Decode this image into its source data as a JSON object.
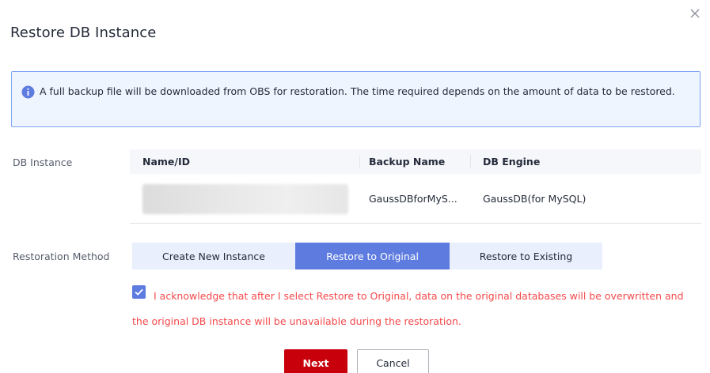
{
  "dialog": {
    "title": "Restore DB Instance",
    "close_icon": "close-icon"
  },
  "notice": {
    "icon": "info-icon",
    "text": "A full backup file will be downloaded from OBS for restoration. The time required depends on the amount of data to be restored."
  },
  "db_instance": {
    "label": "DB Instance",
    "columns": [
      "Name/ID",
      "Backup Name",
      "DB Engine"
    ],
    "rows": [
      {
        "name_id": "",
        "backup_name": "GaussDBforMyS...",
        "db_engine": "GaussDB(for MySQL)"
      }
    ]
  },
  "restoration_method": {
    "label": "Restoration Method",
    "options": [
      "Create New Instance",
      "Restore to Original",
      "Restore to Existing"
    ],
    "selected": "Restore to Original"
  },
  "acknowledge": {
    "checked": true,
    "text": "I acknowledge that after I select Restore to Original, data on the original databases will be overwritten and the original DB instance will be unavailable during the restoration."
  },
  "actions": {
    "next_label": "Next",
    "cancel_label": "Cancel"
  },
  "colors": {
    "accent": "#5e7ce0",
    "primary_button": "#c7000b",
    "warning_text": "#f5494b",
    "notice_border": "#7ea4f5",
    "notice_bg": "#eff5ff"
  }
}
